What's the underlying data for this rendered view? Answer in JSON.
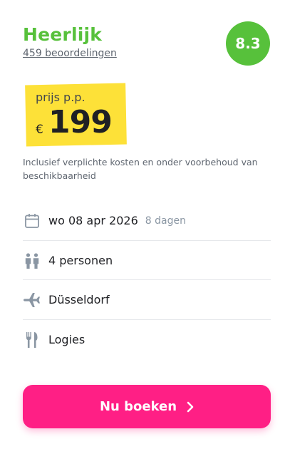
{
  "rating": {
    "label": "Heerlijk",
    "reviews": "459 beoordelingen",
    "score": "8.3"
  },
  "price": {
    "label": "prijs p.p.",
    "currency": "€",
    "amount": "199"
  },
  "disclaimer": "Inclusief verplichte kosten en onder voorbehoud van beschikbaarheid",
  "details": {
    "date": {
      "text": "wo 08 apr 2026",
      "duration": "8 dagen",
      "icon": "calendar-icon"
    },
    "persons": {
      "text": "4 personen",
      "icon": "people-icon"
    },
    "departure": {
      "text": "Düsseldorf",
      "icon": "airplane-icon"
    },
    "board": {
      "text": "Logies",
      "icon": "fork-knife-icon"
    }
  },
  "cta": {
    "label": "Nu boeken",
    "icon": "chevron-right-icon"
  },
  "colors": {
    "rating_green": "#57c13b",
    "price_highlight": "#fde138",
    "cta_pink": "#ff1f85",
    "icon_gray": "#8a96a3"
  }
}
